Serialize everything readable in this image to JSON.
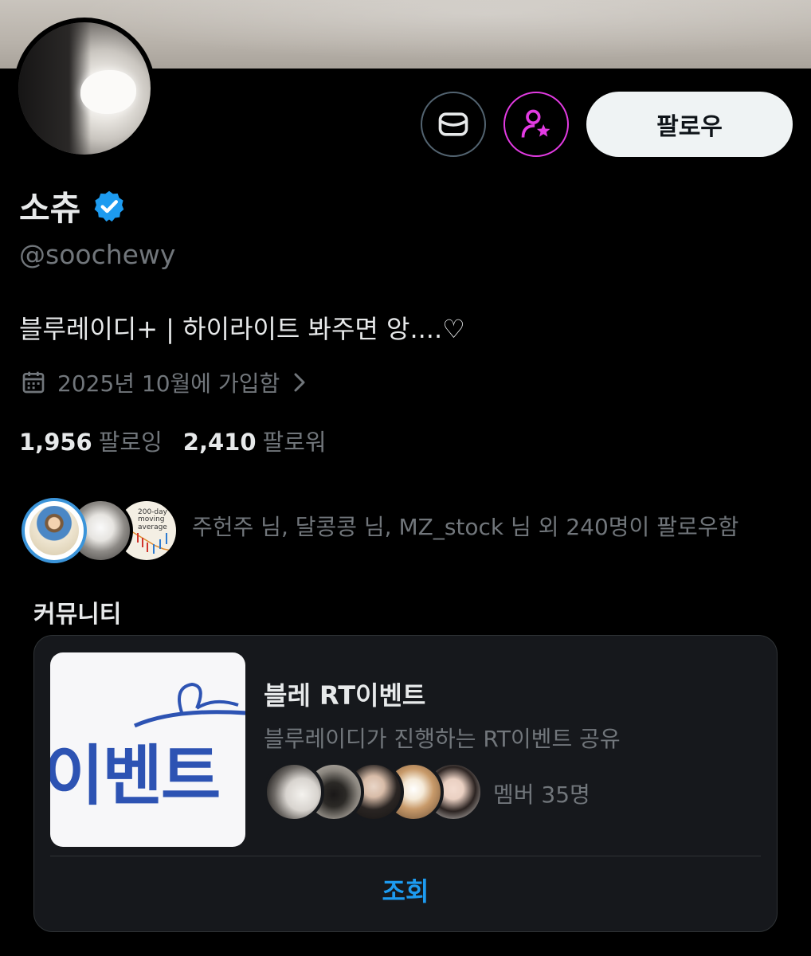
{
  "profile": {
    "display_name": "소츄",
    "handle": "@soochewy",
    "bio": "블루레이디+ | 하이라이트 봐주면 앙....♡",
    "joined": "2025년 10월에 가입함",
    "verified_color": "#1d9bf0"
  },
  "actions": {
    "message_icon": "envelope-icon",
    "subscribe_icon": "person-star-icon",
    "subscribe_color": "#e33be3",
    "follow_label": "팔로우"
  },
  "stats": {
    "following_count": "1,956",
    "following_label": "팔로잉",
    "followers_count": "2,410",
    "followers_label": "팔로워"
  },
  "followed_by": {
    "text": "주헌주 님, 달콩콩 님, MZ_stock 님 외 240명이 팔로우함",
    "chart_avatar_text": "200-day moving average"
  },
  "community": {
    "section_title": "커뮤니티",
    "thumb_text": "이벤트",
    "name": "블레 RT이벤트",
    "description": "블루레이디가 진행하는 RT이벤트 공유",
    "member_count": "멤버 35명",
    "view_label": "조회"
  }
}
